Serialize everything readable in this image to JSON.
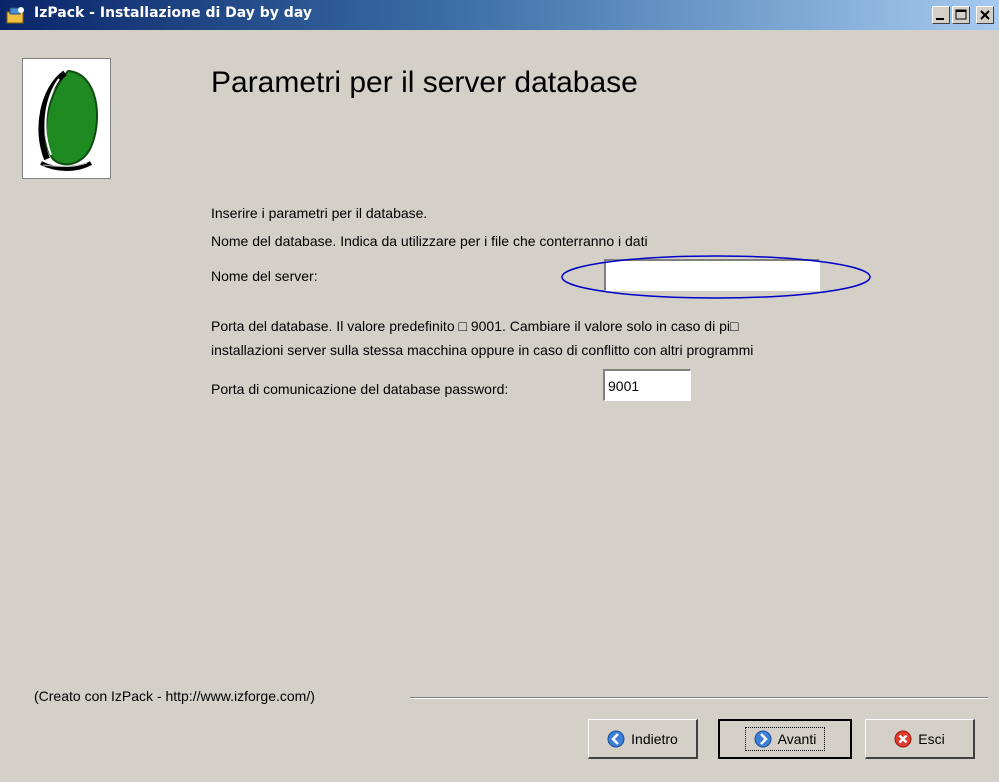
{
  "window": {
    "title": "IzPack - Installazione di Day by day",
    "icon": "installer-icon"
  },
  "header": {
    "title": "Parametri per il server database",
    "logo": "green-leaf-logo"
  },
  "form": {
    "intro": "Inserire i parametri per il database.",
    "db_name_desc": "Nome del database. Indica da utilizzare per i file che conterranno i dati",
    "server_label": "Nome del server:",
    "server_value": "",
    "port_desc_1": "Porta del database. Il valore predefinito □ 9001. Cambiare il valore solo in caso di pi□",
    "port_desc_2": "installazioni server sulla stessa macchina oppure in caso di conflitto con altri programmi",
    "port_label": "Porta di comunicazione del database password:",
    "port_value": "9001",
    "highlight_color": "#0000c8"
  },
  "footer": {
    "credit": "(Creato con IzPack - http://www.izforge.com/)",
    "back_label": "Indietro",
    "next_label": "Avanti",
    "exit_label": "Esci"
  }
}
